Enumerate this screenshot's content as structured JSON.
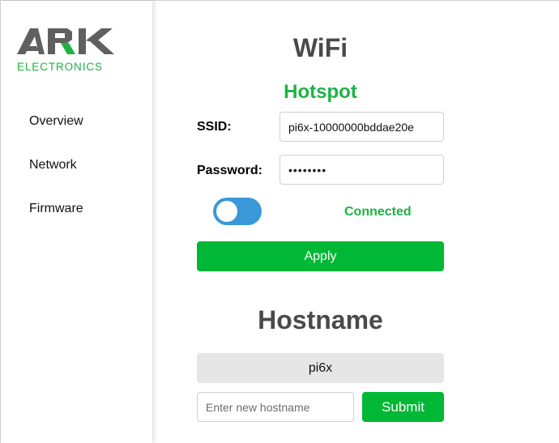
{
  "brand": {
    "logo_wordmark": "ARK",
    "logo_subtitle": "ELECTRONICS",
    "colors": {
      "logo_dark": "#606060",
      "logo_green": "#1db344"
    }
  },
  "sidebar": {
    "items": [
      {
        "label": "Overview"
      },
      {
        "label": "Network"
      },
      {
        "label": "Firmware"
      }
    ]
  },
  "wifi": {
    "title": "WiFi",
    "subtitle": "Hotspot",
    "ssid_label": "SSID:",
    "ssid_value": "pi6x-10000000bddae20e",
    "password_label": "Password:",
    "password_value": "••••••••",
    "toggle_on": true,
    "status": "Connected",
    "apply_label": "Apply"
  },
  "hostname": {
    "title": "Hostname",
    "current": "pi6x",
    "input_placeholder": "Enter new hostname",
    "submit_label": "Submit"
  },
  "colors": {
    "accent_green": "#00b835",
    "status_green": "#1db344",
    "toggle_blue": "#3a98d8",
    "heading_gray": "#4a4a4a"
  }
}
